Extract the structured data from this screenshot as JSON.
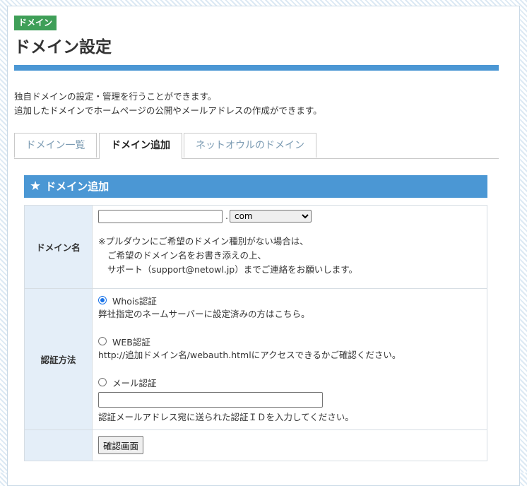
{
  "header": {
    "badge": "ドメイン",
    "title": "ドメイン設定",
    "desc_line1": "独自ドメインの設定・管理を行うことができます。",
    "desc_line2": "追加したドメインでホームページの公開やメールアドレスの作成ができます。"
  },
  "tabs": [
    {
      "label": "ドメイン一覧"
    },
    {
      "label": "ドメイン追加"
    },
    {
      "label": "ネットオウルのドメイン"
    }
  ],
  "section": {
    "icon": "star-icon",
    "title": "ドメイン追加"
  },
  "form": {
    "domain_label": "ドメイン名",
    "domain_value": "",
    "separator": ".",
    "tld_selected": "com",
    "note_lines": [
      "※プルダウンにご希望のドメイン種別がない場合は、",
      "ご希望のドメイン名をお書き添えの上、",
      "サポート（support@netowl.jp）までご連絡をお願いします。"
    ],
    "auth_label": "認証方法",
    "methods": [
      {
        "label": "Whois認証",
        "desc": "弊社指定のネームサーバーに設定済みの方はこちら。",
        "checked": true
      },
      {
        "label": "WEB認証",
        "desc": "http://追加ドメイン名/webauth.htmlにアクセスできるかご確認ください。",
        "checked": false
      },
      {
        "label": "メール認証",
        "desc": "認証メールアドレス宛に送られた認証ＩＤを入力してください。",
        "checked": false
      }
    ],
    "auth_id_value": "",
    "confirm_button": "確認画面"
  },
  "colors": {
    "accent": "#4b97d4",
    "badge": "#3f9f58",
    "label_bg": "#e4eef8"
  }
}
